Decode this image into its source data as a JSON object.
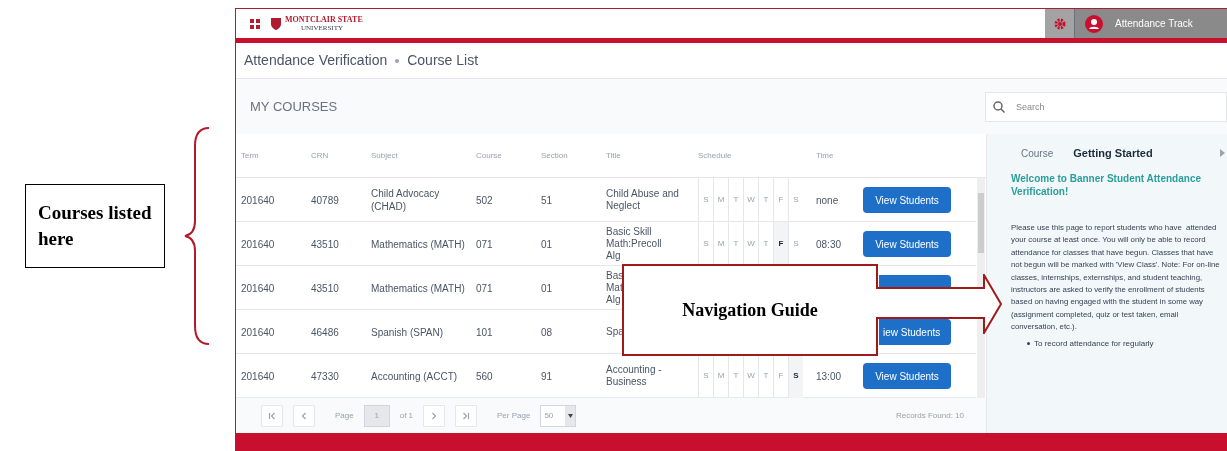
{
  "annotations": {
    "left_label": "Courses listed here",
    "callout": "Navigation Guide"
  },
  "header": {
    "logo_top": "MONTCLAIR STATE",
    "logo_bottom": "UNIVERSITY",
    "user": "Attendance Track"
  },
  "breadcrumb": [
    "Attendance Verification",
    "Course List"
  ],
  "section_title": "MY COURSES",
  "search": {
    "placeholder": "Search"
  },
  "table": {
    "columns": [
      "Term",
      "CRN",
      "Subject",
      "Course",
      "Section",
      "Title",
      "Schedule",
      "Time"
    ],
    "rows": [
      {
        "term": "201640",
        "crn": "40789",
        "subject": "Child Advocacy (CHAD)",
        "course": "502",
        "section": "51",
        "title": [
          "Child Abuse and",
          "Neglect"
        ],
        "days": [
          {
            "letter": "S",
            "on": false
          },
          {
            "letter": "M",
            "on": false
          },
          {
            "letter": "T",
            "on": false
          },
          {
            "letter": "W",
            "on": false
          },
          {
            "letter": "T",
            "on": false
          },
          {
            "letter": "F",
            "on": false
          },
          {
            "letter": "S",
            "on": false
          }
        ],
        "time": "none",
        "action": {
          "kind": "button",
          "label": "View Students"
        }
      },
      {
        "term": "201640",
        "crn": "43510",
        "subject": "Mathematics (MATH)",
        "course": "071",
        "section": "01",
        "title": [
          "Basic Skill",
          "Math:Precoll",
          "Alg"
        ],
        "days": [
          {
            "letter": "S",
            "on": false
          },
          {
            "letter": "M",
            "on": false
          },
          {
            "letter": "T",
            "on": false
          },
          {
            "letter": "W",
            "on": false
          },
          {
            "letter": "T",
            "on": false
          },
          {
            "letter": "F",
            "on": true
          },
          {
            "letter": "S",
            "on": false
          }
        ],
        "time": "08:30",
        "action": {
          "kind": "button",
          "label": "View Students"
        }
      },
      {
        "term": "201640",
        "crn": "43510",
        "subject": "Mathematics (MATH)",
        "course": "071",
        "section": "01",
        "title": [
          "Bas",
          "Mat",
          "Alg"
        ],
        "action": {
          "kind": "sliver"
        }
      },
      {
        "term": "201640",
        "crn": "46486",
        "subject": "Spanish (SPAN)",
        "course": "101",
        "section": "08",
        "title": [
          "Spa"
        ],
        "action": {
          "kind": "button",
          "label": "iew Students"
        }
      },
      {
        "term": "201640",
        "crn": "47330",
        "subject": "Accounting (ACCT)",
        "course": "560",
        "section": "91",
        "title": [
          "Accounting -",
          "Business"
        ],
        "days": [
          {
            "letter": "S",
            "on": false
          },
          {
            "letter": "M",
            "on": false
          },
          {
            "letter": "T",
            "on": false
          },
          {
            "letter": "W",
            "on": false
          },
          {
            "letter": "T",
            "on": false
          },
          {
            "letter": "F",
            "on": false
          },
          {
            "letter": "S",
            "on": true
          }
        ],
        "time": "13:00",
        "action": {
          "kind": "button",
          "label": "View Students"
        }
      }
    ]
  },
  "pagination": {
    "page_label": "Page",
    "page": "1",
    "of": "of 1",
    "per_page_label": "Per Page",
    "per_page": "50",
    "records": "Records Found: 10"
  },
  "sidebar": {
    "tabs": [
      {
        "label": "Course",
        "selected": false
      },
      {
        "label": "Getting Started",
        "selected": true
      }
    ],
    "heading": "Welcome to Banner Student Attendance Verification!",
    "paragraph": "Please use this page to report students who have  attended your course at least once. You will only be able to record attendance for classes that have begun. Classes that have not begun will be marked with 'View Class'. Note: For on-line classes, internships, externships, and student teaching, instructors are asked to verify the enrollment of students based on having engaged with the student in some way (assignment completed, quiz or test taken, email conversation, etc.).",
    "bullets": [
      "To record attendance for regularly"
    ]
  }
}
